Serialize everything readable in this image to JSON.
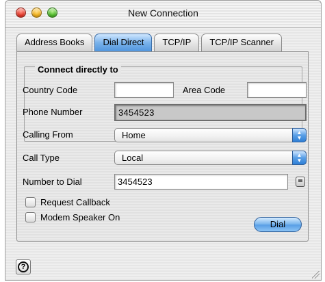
{
  "window": {
    "title": "New Connection"
  },
  "tabs": [
    {
      "label": "Address Books",
      "active": false
    },
    {
      "label": "Dial Direct",
      "active": true
    },
    {
      "label": "TCP/IP",
      "active": false
    },
    {
      "label": "TCP/IP Scanner",
      "active": false
    }
  ],
  "group": {
    "title": "Connect directly to"
  },
  "fields": {
    "country_code": {
      "label": "Country Code",
      "value": ""
    },
    "area_code": {
      "label": "Area Code",
      "value": ""
    },
    "phone_number": {
      "label": "Phone Number",
      "value": "3454523"
    },
    "calling_from": {
      "label": "Calling From",
      "value": "Home"
    },
    "call_type": {
      "label": "Call Type",
      "value": "Local"
    },
    "number_to_dial": {
      "label": "Number to Dial",
      "value": "3454523"
    }
  },
  "checkboxes": {
    "request_callback": {
      "label": "Request Callback",
      "checked": false
    },
    "modem_speaker": {
      "label": "Modem Speaker On",
      "checked": false
    }
  },
  "buttons": {
    "dial": "Dial",
    "help": "?"
  },
  "icons": {
    "dial_settings": "dialing-prefs-icon"
  },
  "colors": {
    "accent": "#5a9fe6",
    "window_bg": "#ececec"
  }
}
